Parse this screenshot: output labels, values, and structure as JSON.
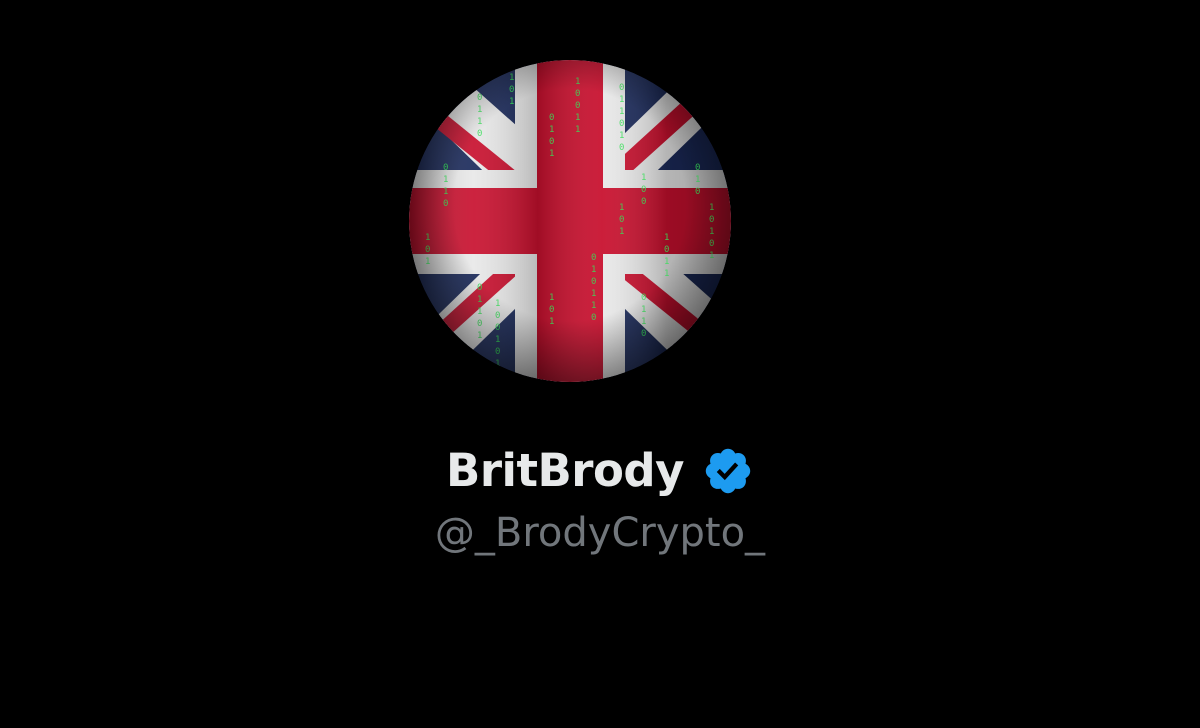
{
  "profile": {
    "display_name": "BritBrody",
    "handle": "@_BrodyCrypto_",
    "verified": true,
    "verified_icon": "verified-badge-icon",
    "avatar_description_icon": "union-jack-flag-avatar"
  },
  "colors": {
    "background": "#000000",
    "name_text": "#e7e9ea",
    "handle_text": "#71767b",
    "verified_blue": "#1d9bf0",
    "flag_red": "#c8102e",
    "flag_blue": "#1b2a5a",
    "flag_white": "#e8e8e8",
    "binary_green": "#39e05a"
  }
}
